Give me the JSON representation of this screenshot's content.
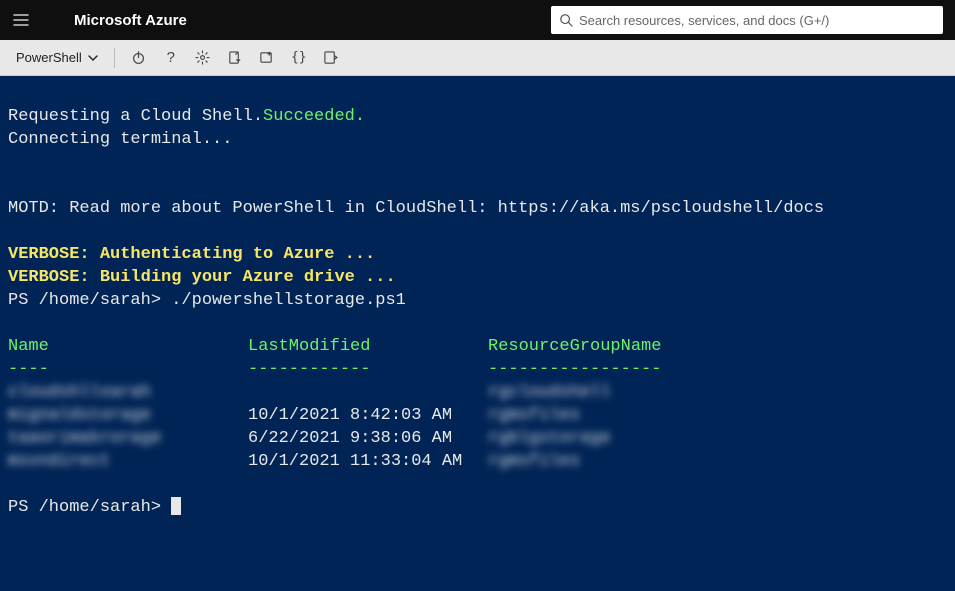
{
  "header": {
    "brand": "Microsoft Azure",
    "search_placeholder": "Search resources, services, and docs (G+/)"
  },
  "toolbar": {
    "shell_label": "PowerShell"
  },
  "terminal": {
    "line_request": "Requesting a Cloud Shell.",
    "status_succeeded": "Succeeded.",
    "line_connect": "Connecting terminal...",
    "motd": "MOTD: Read more about PowerShell in CloudShell: https://aka.ms/pscloudshell/docs",
    "verbose1": "VERBOSE: Authenticating to Azure ...",
    "verbose2": "VERBOSE: Building your Azure drive ...",
    "prompt_prefix": "PS /home/sarah>",
    "command": "./powershellstorage.ps1",
    "headers": {
      "name": "Name",
      "modified": "LastModified",
      "rg": "ResourceGroupName"
    },
    "underlines": {
      "name": "----",
      "modified": "------------",
      "rg": "-----------------"
    },
    "rows": [
      {
        "name": "cloudshllsarah",
        "modified": "",
        "rg": "rgcloudshell"
      },
      {
        "name": "mignaldstorage",
        "modified": "10/1/2021 8:42:03 AM",
        "rg": "rgmsfiles"
      },
      {
        "name": "taaorimakrorage",
        "modified": "6/22/2021 9:38:06 AM",
        "rg": "rgblgstorage"
      },
      {
        "name": "msvndirect",
        "modified": "10/1/2021 11:33:04 AM",
        "rg": "rgmsfiles"
      }
    ]
  }
}
